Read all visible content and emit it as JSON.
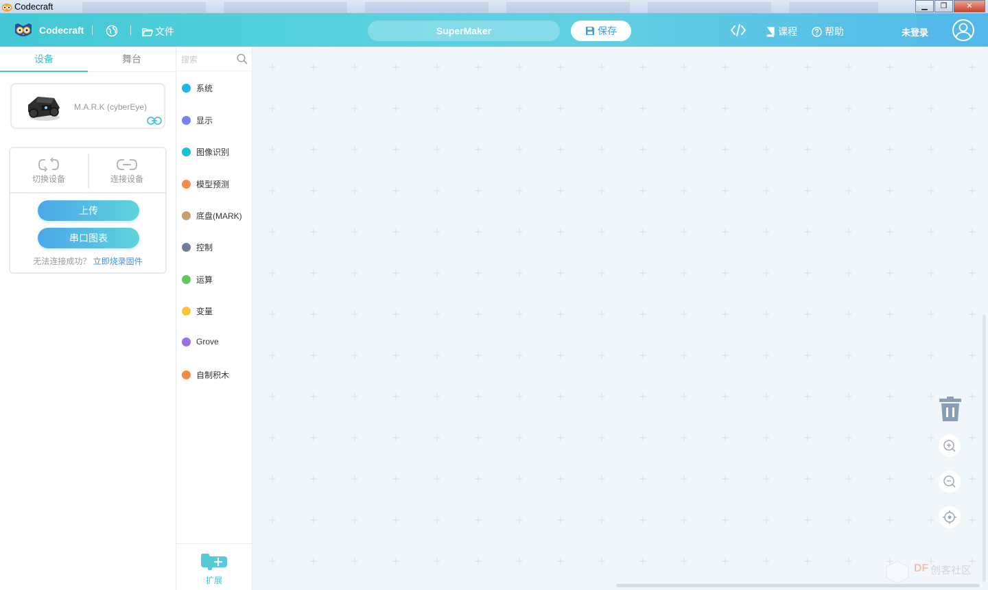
{
  "window": {
    "title": "Codecraft"
  },
  "header": {
    "brand": "Codecraft",
    "file_label": "文件",
    "project_name": "SuperMaker",
    "save_label": "保存",
    "course_label": "课程",
    "help_label": "帮助",
    "login_label": "未登录"
  },
  "left": {
    "tabs": [
      {
        "label": "设备",
        "active": true
      },
      {
        "label": "舞台",
        "active": false
      }
    ],
    "device": {
      "name": "M.A.R.K (cyberEye)"
    },
    "ops": {
      "switch_label": "切换设备",
      "connect_label": "连接设备"
    },
    "upload_label": "上传",
    "serial_label": "串口图表",
    "hint_text": "无法连接成功？",
    "hint_link": "立即烧录固件"
  },
  "categories": {
    "search_placeholder": "搜索",
    "items": [
      {
        "label": "系统",
        "color": "#1eb3f3"
      },
      {
        "label": "显示",
        "color": "#7b7ff0"
      },
      {
        "label": "图像识别",
        "color": "#19c2cc"
      },
      {
        "label": "模型预测",
        "color": "#f68a4a"
      },
      {
        "label": "底盘(MARK)",
        "color": "#c79e6e"
      },
      {
        "label": "控制",
        "color": "#6f7f99"
      },
      {
        "label": "运算",
        "color": "#5cc95c"
      },
      {
        "label": "变量",
        "color": "#f7c53a"
      },
      {
        "label": "Grove",
        "color": "#9b6fe6"
      },
      {
        "label": "自制积木",
        "color": "#f68a3e"
      }
    ],
    "extend_label": "扩展"
  },
  "watermark": {
    "brand": "DF",
    "name": "创客社区"
  }
}
